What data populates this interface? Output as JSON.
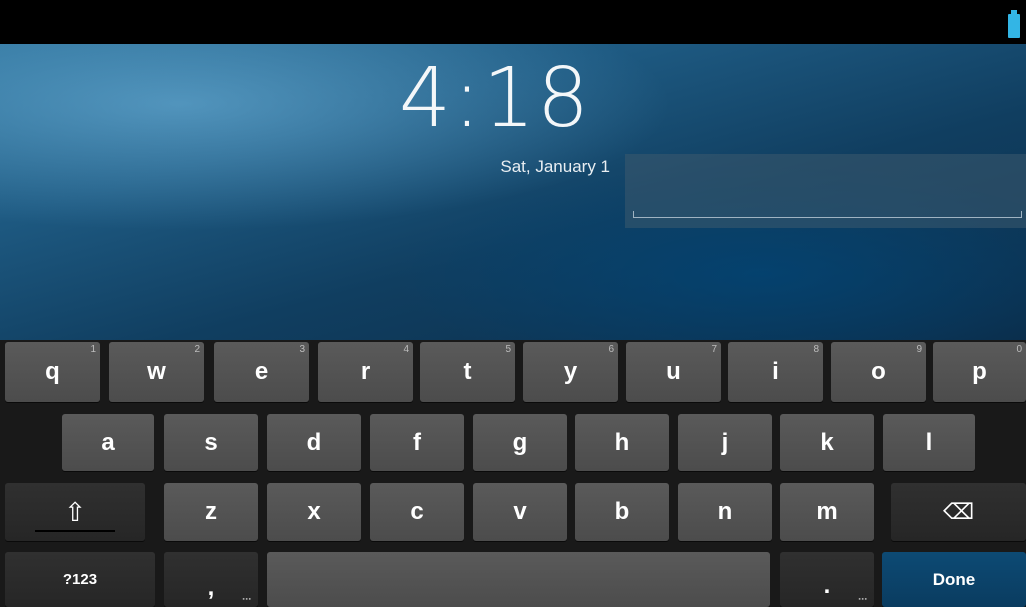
{
  "lockscreen": {
    "time": "4:18",
    "date": "Sat, January 1"
  },
  "keyboard": {
    "row1": [
      {
        "label": "q",
        "hint": "1"
      },
      {
        "label": "w",
        "hint": "2"
      },
      {
        "label": "e",
        "hint": "3"
      },
      {
        "label": "r",
        "hint": "4"
      },
      {
        "label": "t",
        "hint": "5"
      },
      {
        "label": "y",
        "hint": "6"
      },
      {
        "label": "u",
        "hint": "7"
      },
      {
        "label": "i",
        "hint": "8"
      },
      {
        "label": "o",
        "hint": "9"
      },
      {
        "label": "p",
        "hint": "0"
      }
    ],
    "row2": [
      "a",
      "s",
      "d",
      "f",
      "g",
      "h",
      "j",
      "k",
      "l"
    ],
    "row3": [
      "z",
      "x",
      "c",
      "v",
      "b",
      "n",
      "m"
    ],
    "shift_icon": "⇧",
    "backspace_icon": "⌫",
    "symbols_label": "?123",
    "comma_label": ",",
    "period_label": ".",
    "done_label": "Done"
  }
}
